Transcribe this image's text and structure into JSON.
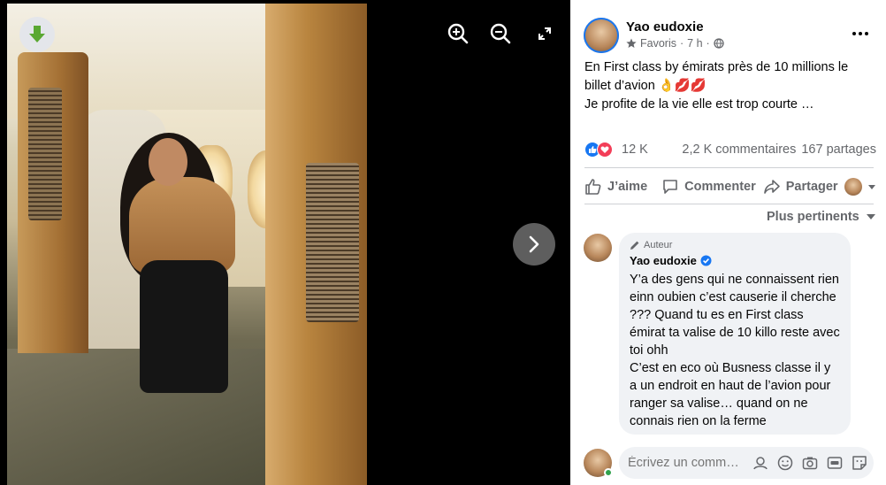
{
  "post": {
    "author": "Yao eudoxie",
    "meta_label": "Favoris",
    "meta_sep": "·",
    "meta_time": "7 h",
    "meta_dot": "·",
    "text_line1": "En First class by émirats près de 10 millions le",
    "text_line2": "billet d’avion 👌💋💋",
    "text_line3": "Je profite de la vie elle est trop courte …",
    "reactions_count": "12 K",
    "comments_count": "2,2 K commentaires",
    "shares_count": "167 partages"
  },
  "actions": {
    "like": "J’aime",
    "comment": "Commenter",
    "share": "Partager"
  },
  "sort_label": "Plus pertinents",
  "comment": {
    "author_tag": "Auteur",
    "author": "Yao eudoxie",
    "text": "Y’a des gens qui ne connaissent rien einn oubien c’est causerie il cherche ??? Quand tu es en First class émirat ta valise de 10 killo reste avec toi ohh",
    "text2": "C’est en eco où Busness classe il y a un endroit en haut de l’avion pour ranger sa valise… quand on ne connais rien on la ferme"
  },
  "composer": {
    "placeholder": "Écrivez un comm…"
  },
  "colors": {
    "like_blue": "#1877f2",
    "love_red": "#f33e58",
    "verified_blue": "#1877f2",
    "online_green": "#31a24c"
  }
}
